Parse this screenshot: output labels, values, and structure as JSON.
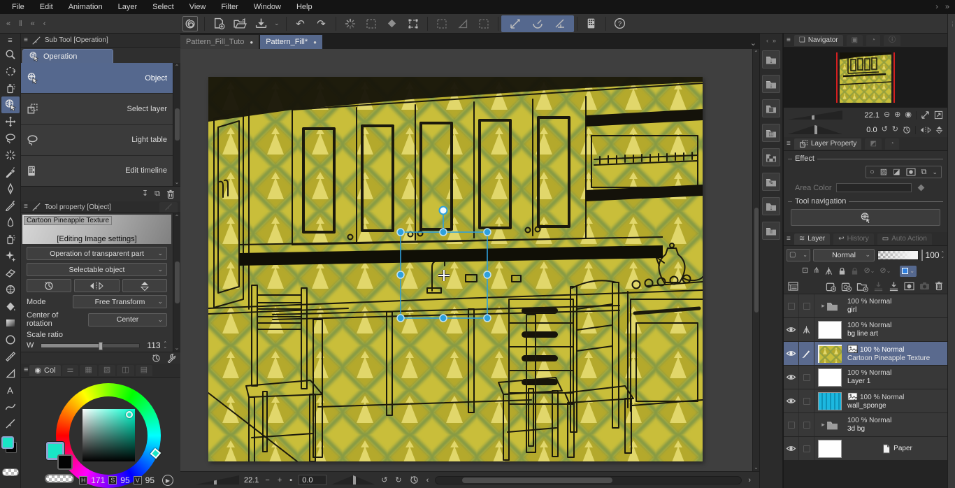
{
  "menu": {
    "items": [
      "File",
      "Edit",
      "Animation",
      "Layer",
      "Select",
      "View",
      "Filter",
      "Window",
      "Help"
    ]
  },
  "tabs": {
    "inactive": "Pattern_Fill_Tuto",
    "active": "Pattern_Fill*"
  },
  "subtool": {
    "title": "Sub Tool [Operation]",
    "tab": "Operation",
    "items": [
      {
        "label": "Object"
      },
      {
        "label": "Select layer"
      },
      {
        "label": "Light table"
      },
      {
        "label": "Edit timeline"
      }
    ]
  },
  "toolprop": {
    "title": "Tool property [Object]",
    "material": "Cartoon Pineapple Texture",
    "editing": "[Editing Image settings]",
    "dd1": "Operation of transparent part",
    "dd2": "Selectable object",
    "mode_label": "Mode",
    "mode": "Free Transform",
    "center_label": "Center of rotation",
    "center": "Center",
    "scale_label": "Scale ratio",
    "axis": "W",
    "scale": "113"
  },
  "colorwheel": {
    "tab": "Col",
    "h_label": "H",
    "h": "171",
    "s_label": "S",
    "s": "95",
    "v_label": "V",
    "v": "95",
    "foreground": "#19e5c6",
    "background": "#000000"
  },
  "navigator": {
    "title": "Navigator",
    "zoom": "22.1",
    "rotation": "0.0"
  },
  "layerprop": {
    "title": "Layer Property",
    "effect": "Effect",
    "area_color": "Area Color",
    "tool_nav": "Tool navigation"
  },
  "layerpanel": {
    "tab_layer": "Layer",
    "tab_history": "History",
    "tab_auto": "Auto Action",
    "blend": "Normal",
    "opacity": "100",
    "rows": [
      {
        "info": "100 % Normal",
        "name": "girl"
      },
      {
        "info": "100 % Normal",
        "name": "bg line art"
      },
      {
        "info": "100 % Normal",
        "name": "Cartoon Pineapple Texture"
      },
      {
        "info": "100 % Normal",
        "name": "Layer 1"
      },
      {
        "info": "100 % Normal",
        "name": "wall_sponge"
      },
      {
        "info": "100 % Normal",
        "name": "3d bg"
      },
      {
        "info": "",
        "name": "Paper"
      }
    ]
  },
  "status": {
    "zoom": "22.1",
    "rotation": "0.0"
  },
  "colors": {
    "accent": "#56688c",
    "handle_blue": "#2da0dd",
    "canvas_yellow": "#c9be3a",
    "sponge_cyan": "#1cb8e0"
  }
}
